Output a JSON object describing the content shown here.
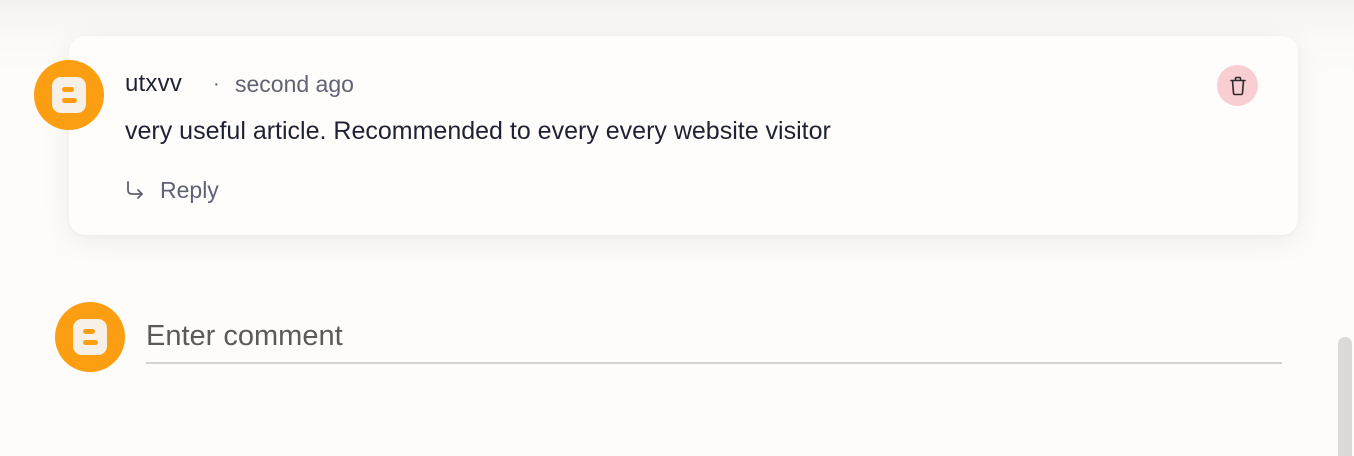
{
  "comment": {
    "author": "utxvv",
    "separator": "·",
    "timestamp": "second ago",
    "text": "very useful article. Recommended to every every website visitor",
    "reply_label": "Reply",
    "avatar_icon": "blogger-icon",
    "delete_icon": "trash-icon"
  },
  "compose": {
    "placeholder": "Enter comment",
    "avatar_icon": "blogger-icon"
  },
  "colors": {
    "avatar": "#fb9e12",
    "delete_button_bg": "#f9ced3",
    "text_primary": "#1f2233",
    "text_secondary": "#5f6373"
  }
}
